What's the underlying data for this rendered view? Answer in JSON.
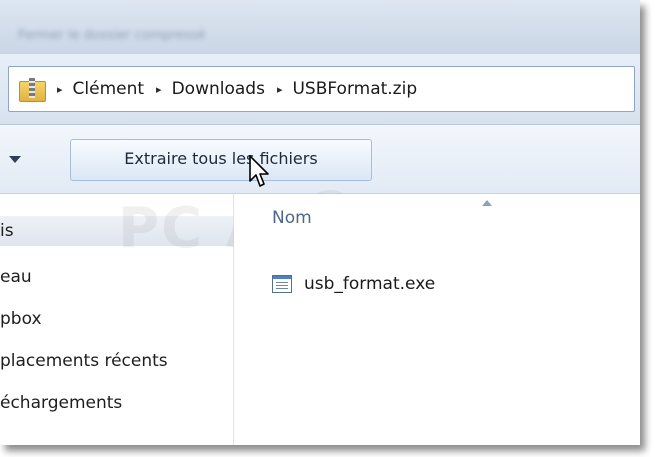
{
  "window": {
    "title_blurred": "Fermer le dossier compressé"
  },
  "address": {
    "separator": "▸",
    "crumbs": [
      "Clément",
      "Downloads",
      "USBFormat.zip"
    ]
  },
  "toolbar": {
    "extract_label": "Extraire tous les fichiers"
  },
  "nav": {
    "items": [
      {
        "label": "is",
        "selected": true
      },
      {
        "label": "eau",
        "selected": false
      },
      {
        "label": "pbox",
        "selected": false
      },
      {
        "label": "placements récents",
        "selected": false
      },
      {
        "label": "échargements",
        "selected": false
      }
    ]
  },
  "content": {
    "column_header": "Nom",
    "files": [
      {
        "name": "usb_format.exe",
        "icon": "executable-icon"
      }
    ]
  },
  "watermark": {
    "text": "PC ASTUCES"
  },
  "colors": {
    "accent": "#4d7fc2",
    "header_text": "#4f6786"
  }
}
